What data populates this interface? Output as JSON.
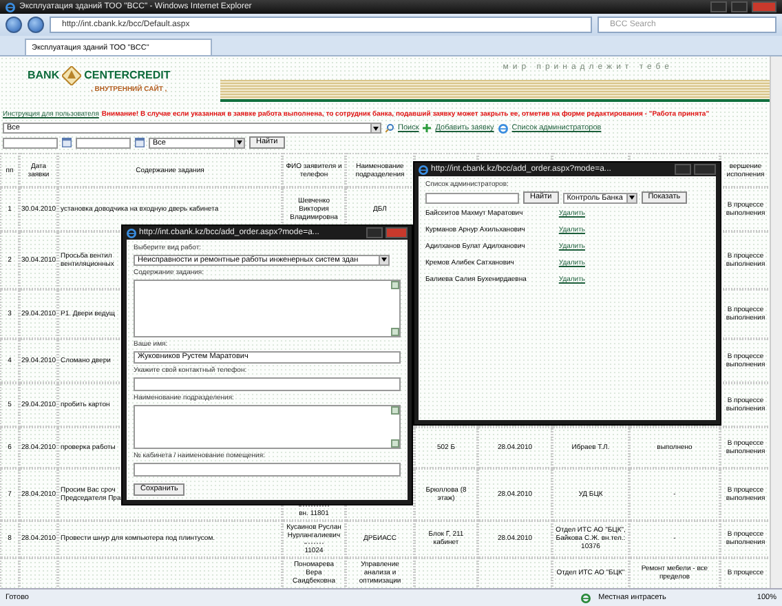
{
  "window": {
    "title": "Эксплуатация зданий ТОО \"BCC\" - Windows Internet Explorer"
  },
  "address_bar": {
    "url": "http://int.cbank.kz/bcc/Default.aspx",
    "search_placeholder": "BCC Search"
  },
  "tabs": [
    {
      "label": "Эксплуатация зданий ТОО \"BCC\"",
      "selected": true
    }
  ],
  "header": {
    "slogan": "мир принадлежит тебе",
    "logo_word_1": "BANK",
    "logo_word_2": "CENTERCREDIT",
    "subtitle": ", ВНУТРЕННИЙ САЙТ ,"
  },
  "notice": {
    "link": "Инструкция для пользователя",
    "warning": "Внимание! В случае если указанная в заявке работа выполнена, то сотрудник банка, подавший заявку может закрыть ее, отметив на форме редактирования - \"Работа принята\""
  },
  "filters": {
    "category": "Все",
    "search_link": "Поиск",
    "add_link": "Добавить заявку",
    "admins_link": "Список администраторов",
    "status": "Все",
    "search_button": "Найти"
  },
  "table": {
    "columns": [
      "пп",
      "Дата заявки",
      "Содержание задания",
      "ФИО заявителя и телефон",
      "Наименование подразделения",
      "вершение исполнения"
    ],
    "rows": [
      {
        "number": "1",
        "date": "30.04.2010",
        "task": "установка доводчика на входную дверь кабинета",
        "applicant": "Шевченко Виктория Владимировна",
        "department": "ДБЛ",
        "status": "В процессе выполнения"
      },
      {
        "number": "2",
        "date": "30.04.2010",
        "task": "Просьба вентил\nвентиляционных",
        "status": "В процессе выполнения"
      },
      {
        "number": "3",
        "date": "29.04.2010",
        "task": "Р1. Двери ведущ",
        "status": "В процессе выполнения"
      },
      {
        "number": "4",
        "date": "29.04.2010",
        "task": "Сломано двери",
        "status": "В процессе выполнения"
      },
      {
        "number": "5",
        "date": "29.04.2010",
        "task": "пробить картон",
        "status": "В процессе выполнения"
      },
      {
        "number": "6",
        "date": "28.04.2010",
        "task": "проверка работы",
        "place": "502 Б",
        "due_date": "28.04.2010",
        "executor": "Ибраев Т.Л.",
        "comment": "выполнено",
        "status": "В процессе выполнения"
      },
      {
        "number": "7",
        "date": "28.04.2010",
        "task": "Просим Вас сроч\nПредседателя Пра",
        "phone": "вн. 11801",
        "place": "Брюллова (8 этаж)",
        "due_date": "28.04.2010",
        "executor": "УД БЦК",
        "comment": "-",
        "status": "В процессе выполнения"
      },
      {
        "number": "8",
        "date": "28.04.2010",
        "task": "Провести шнур для компьютера под плинтусом.",
        "applicant": "Кусаинов Руслан Нурлангалиевич",
        "phone": "11024",
        "department": "ДРБИАСС",
        "place": "Блок Г, 211 кабинет",
        "due_date": "28.04.2010",
        "executor": "Отдел ИТС АО \"БЦК\", Байкова С.Ж. вн.тел.: 10376",
        "comment": "-",
        "status": "В процессе выполнения"
      },
      {
        "applicant": "Пономарева Вера Саидбековна",
        "department": "Управление анализа и оптимизации",
        "executor": "Отдел ИТС АО \"БЦК\"",
        "comment": "Ремонт мебели - все пределов",
        "status": "В процессе"
      }
    ]
  },
  "admin_window": {
    "title": "http://int.cbank.kz/bcc/add_order.aspx?mode=a...",
    "heading": "Список администраторов:",
    "search_button": "Найти",
    "group": "Контроль Банка",
    "show_button": "Показать",
    "admins": [
      {
        "name": "Байсеитов Махмут Маратович",
        "action": "Удалить"
      },
      {
        "name": "Курманов Арнур Ахильханович",
        "action": "Удалить"
      },
      {
        "name": "Адилханов Булат Адилханович",
        "action": "Удалить"
      },
      {
        "name": "Кремов Алибек Сатханович",
        "action": "Удалить"
      },
      {
        "name": "Балиева Салия Бухенирдаевна",
        "action": "Удалить"
      }
    ]
  },
  "order_window": {
    "title": "http://int.cbank.kz/bcc/add_order.aspx?mode=a...",
    "fields": [
      {
        "kind": "select",
        "label": "Выберите вид работ:",
        "value": "Неисправности и ремонтные работы инженерных систем здан"
      },
      {
        "kind": "textarea",
        "label": "Содержание задания:"
      },
      {
        "kind": "input",
        "label": "Ваше имя:",
        "value": "Жуковников Рустем Маратович"
      },
      {
        "kind": "input",
        "label": "Укажите свой контактный телефон:"
      },
      {
        "kind": "textarea",
        "label": "Наименование подразделения:"
      },
      {
        "kind": "input",
        "label": "№ кабинета / наименование помещения:"
      }
    ],
    "button": "Сохранить"
  },
  "status_bar": {
    "text": "Готово",
    "zone": "Местная интрасеть",
    "zoom": "100%"
  }
}
